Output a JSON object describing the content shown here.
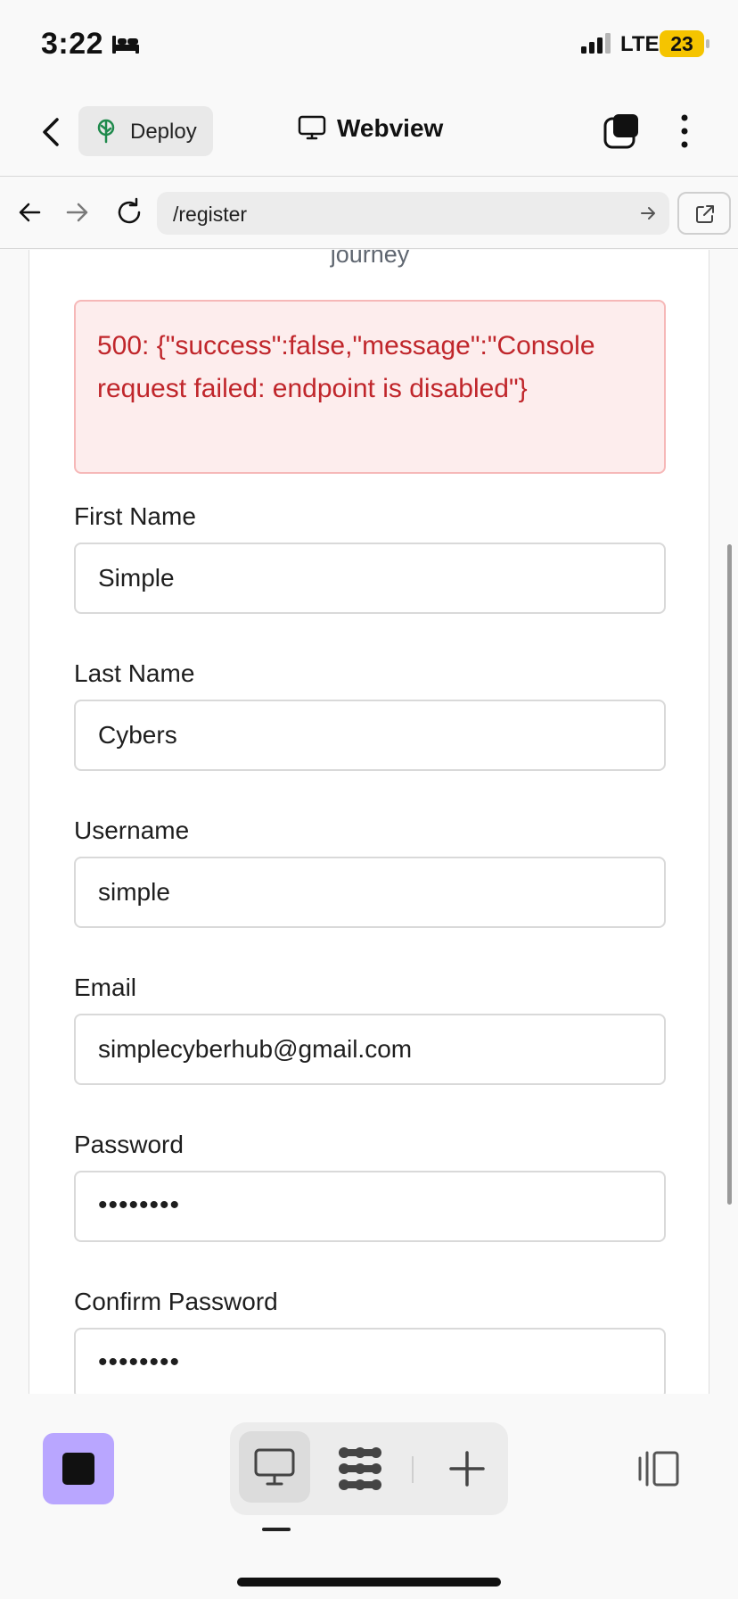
{
  "status_bar": {
    "time": "3:22",
    "network": "LTE",
    "battery": "23"
  },
  "header": {
    "deploy_label": "Deploy",
    "title": "Webview"
  },
  "url_bar": {
    "url": "/register"
  },
  "page": {
    "subtitle_fragment": "journey",
    "error_message": "500: {\"success\":false,\"message\":\"Console request failed: endpoint is disabled\"}",
    "fields": [
      {
        "label": "First Name",
        "value": "Simple"
      },
      {
        "label": "Last Name",
        "value": "Cybers"
      },
      {
        "label": "Username",
        "value": "simple"
      },
      {
        "label": "Email",
        "value": "simplecyberhub@gmail.com"
      },
      {
        "label": "Password",
        "value": "••••••••"
      },
      {
        "label": "Confirm Password",
        "value": "••••••••"
      }
    ]
  },
  "colors": {
    "error_text": "#c0262b",
    "error_bg": "#fdeded",
    "accent_button": "#b9a6ff"
  }
}
